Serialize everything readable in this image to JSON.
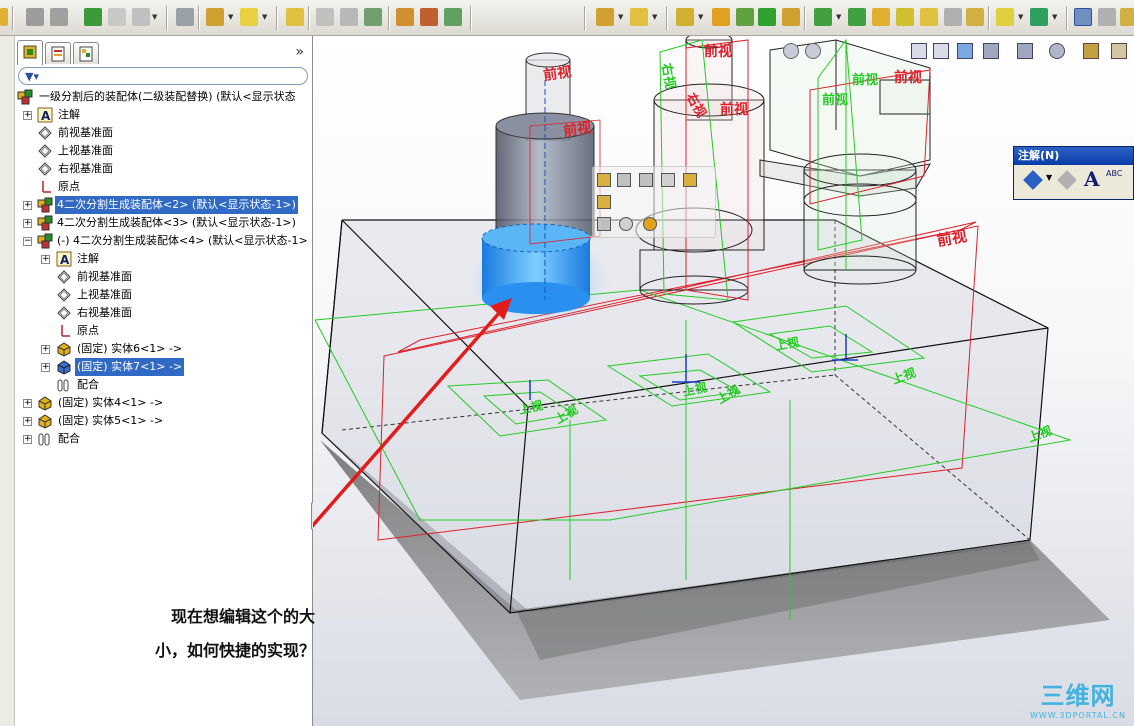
{
  "feature_tree": {
    "root": "一级分割后的装配体(二级装配替换)  (默认<显示状态",
    "items": [
      {
        "label": "注解"
      },
      {
        "label": "前视基准面"
      },
      {
        "label": "上视基准面"
      },
      {
        "label": "右视基准面"
      },
      {
        "label": "原点"
      },
      {
        "label": "4二次分割生成装配体<2> (默认<显示状态-1>)"
      },
      {
        "label": "4二次分割生成装配体<3> (默认<显示状态-1>)"
      },
      {
        "label": "(-) 4二次分割生成装配体<4> (默认<显示状态-1>"
      },
      {
        "label": "注解"
      },
      {
        "label": "前视基准面"
      },
      {
        "label": "上视基准面"
      },
      {
        "label": "右视基准面"
      },
      {
        "label": "原点"
      },
      {
        "label": "(固定) 实体6<1> ->"
      },
      {
        "label": "(固定) 实体7<1> ->"
      },
      {
        "label": "配合"
      },
      {
        "label": "(固定) 实体4<1> ->"
      },
      {
        "label": "(固定) 实体5<1> ->"
      },
      {
        "label": "配合"
      }
    ]
  },
  "annotation_panel": {
    "title": "注解(N)"
  },
  "plane_labels": {
    "front": "前视",
    "top": "上视",
    "right": "右视"
  },
  "question": {
    "line1": "现在想编辑这个的大",
    "line2": "小，如何快捷的实现？"
  },
  "watermark": {
    "big": "三维网",
    "small": "WWW.3DPORTAL.CN"
  },
  "colors": {
    "selection": "#316ac5",
    "plane_red": "#e0202a",
    "plane_green": "#22cc22",
    "arrow": "#e21b1b",
    "highlight_blue": "#1e90ff"
  }
}
